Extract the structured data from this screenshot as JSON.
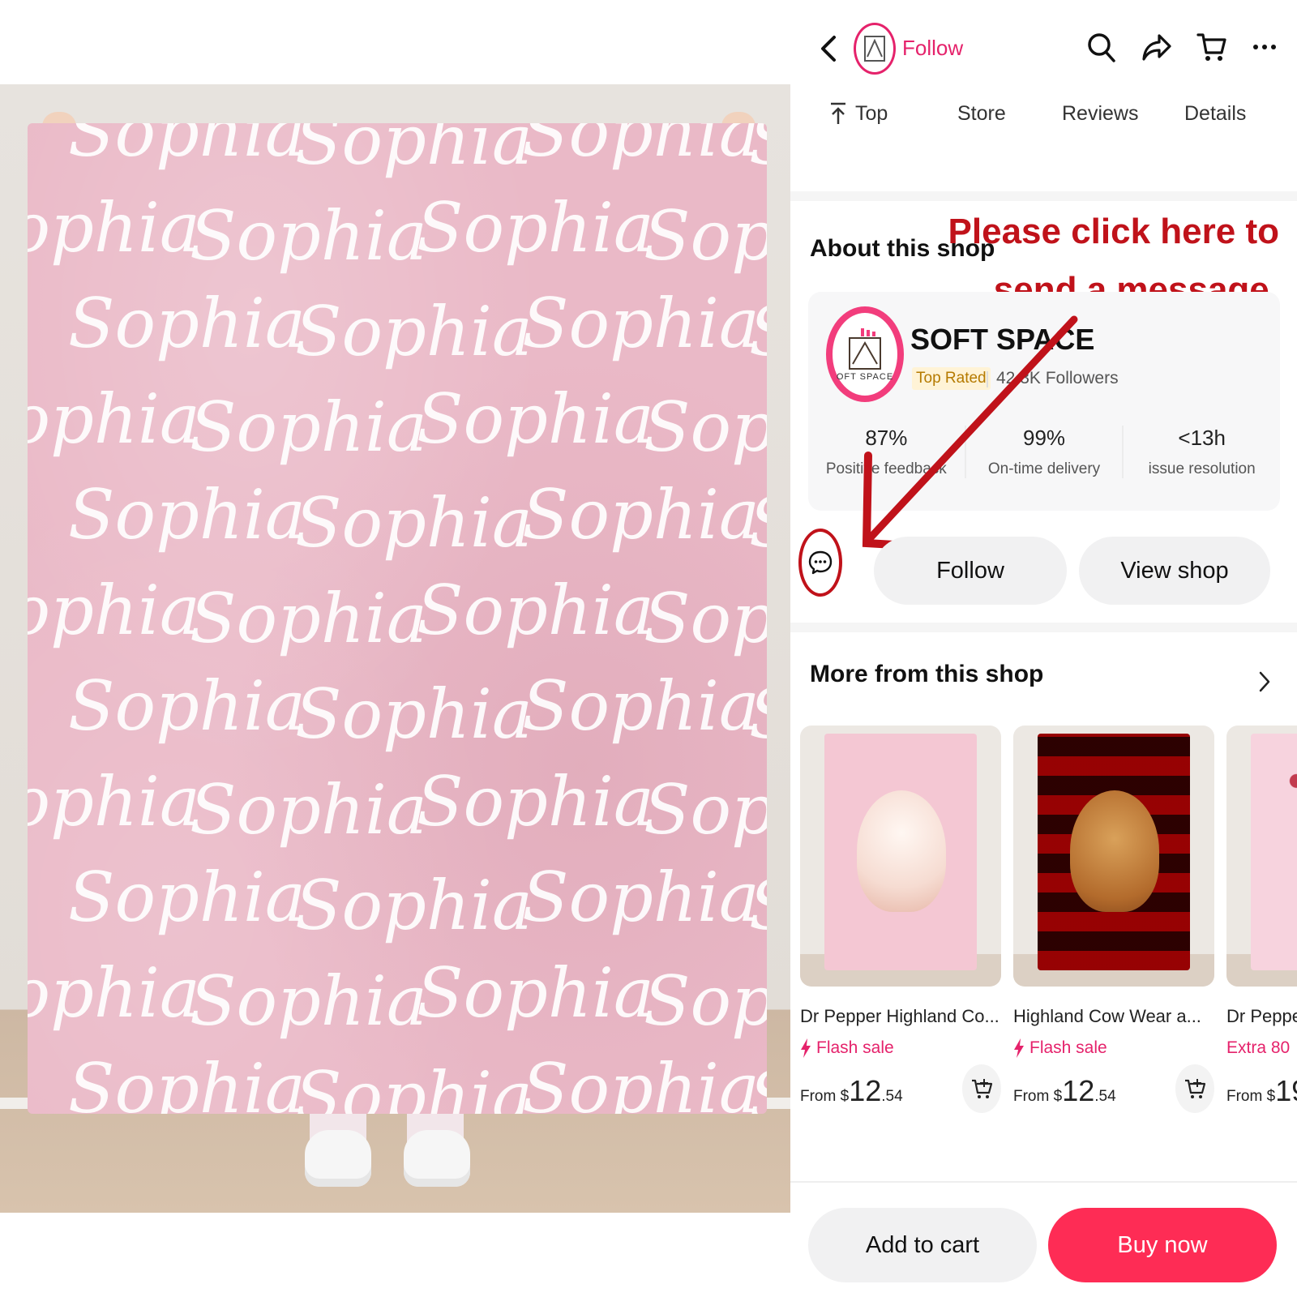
{
  "product_image": {
    "pattern_text": "Sophia"
  },
  "header": {
    "follow_label": "Follow",
    "icons": [
      "back-icon",
      "search-icon",
      "share-icon",
      "cart-icon",
      "more-icon"
    ]
  },
  "tabs": [
    {
      "label": "Top",
      "icon": "arrow-up-to-top-icon"
    },
    {
      "label": "Store"
    },
    {
      "label": "Reviews"
    },
    {
      "label": "Details"
    }
  ],
  "about": {
    "title": "About this shop",
    "annotation_line1": "Please click here to",
    "annotation_line2": "send a message.",
    "shop_name": "SOFT SPACE",
    "logo_text": "OFT SPACE",
    "badge": "Top Rated",
    "followers": "42.3K Followers",
    "stats": [
      {
        "value": "87%",
        "label": "Positive feedback"
      },
      {
        "value": "99%",
        "label": "On-time delivery"
      },
      {
        "value": "<13h",
        "label": "issue resolution"
      }
    ],
    "follow_button": "Follow",
    "view_shop_button": "View shop"
  },
  "more": {
    "title": "More from this shop",
    "products": [
      {
        "title": "Dr Pepper Highland Co...",
        "promo": "Flash sale",
        "price_prefix": "From $",
        "price_main": "12",
        "price_cents": ".54"
      },
      {
        "title": "Highland Cow Wear a...",
        "promo": "Flash sale",
        "price_prefix": "From $",
        "price_main": "12",
        "price_cents": ".54"
      },
      {
        "title": "Dr Peppe",
        "promo": "Extra 80",
        "price_prefix": "From $",
        "price_main": "19",
        "price_cents": ""
      }
    ]
  },
  "bottom_bar": {
    "add_to_cart": "Add to cart",
    "buy_now": "Buy now"
  },
  "colors": {
    "brand_pink": "#e5226b",
    "buy_now_red": "#fe2c55",
    "annotation_red": "#c0121a",
    "blanket_pink": "#eab9c7"
  }
}
